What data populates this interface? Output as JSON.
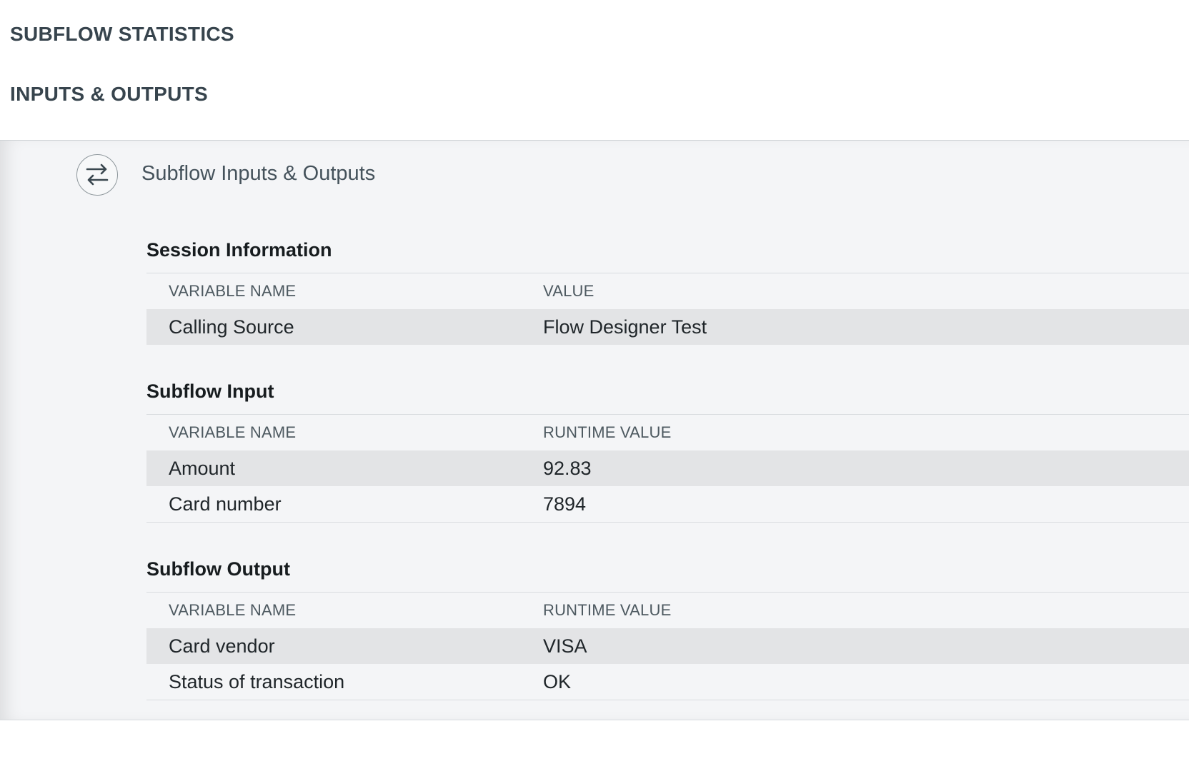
{
  "sections": {
    "subflow_statistics": "SUBFLOW STATISTICS",
    "inputs_outputs": "INPUTS & OUTPUTS"
  },
  "panel": {
    "title": "Subflow Inputs & Outputs",
    "icon": "swap-arrows-icon"
  },
  "session_information": {
    "title": "Session Information",
    "col_name": "VARIABLE NAME",
    "col_value": "VALUE",
    "rows": [
      {
        "name": "Calling Source",
        "value": "Flow Designer Test"
      }
    ]
  },
  "subflow_input": {
    "title": "Subflow Input",
    "col_name": "VARIABLE NAME",
    "col_value": "RUNTIME VALUE",
    "rows": [
      {
        "name": "Amount",
        "value": "92.83"
      },
      {
        "name": "Card number",
        "value": "7894"
      }
    ]
  },
  "subflow_output": {
    "title": "Subflow Output",
    "col_name": "VARIABLE NAME",
    "col_value": "RUNTIME VALUE",
    "rows": [
      {
        "name": "Card vendor",
        "value": "VISA"
      },
      {
        "name": "Status of transaction",
        "value": "OK"
      }
    ]
  }
}
